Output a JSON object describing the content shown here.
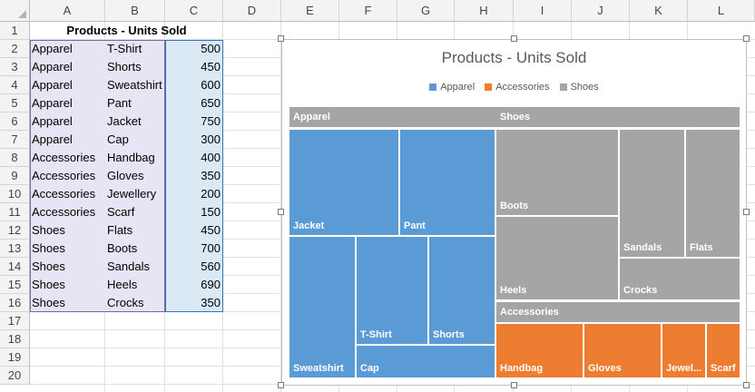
{
  "sheet": {
    "columns": [
      "A",
      "B",
      "C",
      "D",
      "E",
      "F",
      "G",
      "H",
      "I",
      "J",
      "K",
      "L"
    ],
    "rows": [
      "1",
      "2",
      "3",
      "4",
      "5",
      "6",
      "7",
      "8",
      "9",
      "10",
      "11",
      "12",
      "13",
      "14",
      "15",
      "16",
      "17",
      "18",
      "19",
      "20"
    ],
    "title": "Products - Units Sold",
    "data": [
      {
        "category": "Apparel",
        "product": "T-Shirt",
        "units": "500"
      },
      {
        "category": "Apparel",
        "product": "Shorts",
        "units": "450"
      },
      {
        "category": "Apparel",
        "product": "Sweatshirt",
        "units": "600"
      },
      {
        "category": "Apparel",
        "product": "Pant",
        "units": "650"
      },
      {
        "category": "Apparel",
        "product": "Jacket",
        "units": "750"
      },
      {
        "category": "Apparel",
        "product": "Cap",
        "units": "300"
      },
      {
        "category": "Accessories",
        "product": "Handbag",
        "units": "400"
      },
      {
        "category": "Accessories",
        "product": "Gloves",
        "units": "350"
      },
      {
        "category": "Accessories",
        "product": "Jewellery",
        "units": "200"
      },
      {
        "category": "Accessories",
        "product": "Scarf",
        "units": "150"
      },
      {
        "category": "Shoes",
        "product": "Flats",
        "units": "450"
      },
      {
        "category": "Shoes",
        "product": "Boots",
        "units": "700"
      },
      {
        "category": "Shoes",
        "product": "Sandals",
        "units": "560"
      },
      {
        "category": "Shoes",
        "product": "Heels",
        "units": "690"
      },
      {
        "category": "Shoes",
        "product": "Crocks",
        "units": "350"
      }
    ]
  },
  "chart_data": {
    "type": "treemap",
    "title": "Products - Units Sold",
    "legend": {
      "position": "top",
      "entries": [
        "Apparel",
        "Accessories",
        "Shoes"
      ]
    },
    "colors": {
      "Apparel": "#5b9bd5",
      "Accessories": "#ed7d31",
      "Shoes": "#a5a5a5"
    },
    "groups": [
      {
        "name": "Apparel",
        "items": [
          {
            "label": "Jacket",
            "value": 750
          },
          {
            "label": "Pant",
            "value": 650
          },
          {
            "label": "Sweatshirt",
            "value": 600
          },
          {
            "label": "T-Shirt",
            "value": 500
          },
          {
            "label": "Shorts",
            "value": 450
          },
          {
            "label": "Cap",
            "value": 300
          }
        ]
      },
      {
        "name": "Shoes",
        "items": [
          {
            "label": "Boots",
            "value": 700
          },
          {
            "label": "Heels",
            "value": 690
          },
          {
            "label": "Sandals",
            "value": 560
          },
          {
            "label": "Flats",
            "value": 450
          },
          {
            "label": "Crocks",
            "value": 350
          }
        ]
      },
      {
        "name": "Accessories",
        "items": [
          {
            "label": "Handbag",
            "value": 400
          },
          {
            "label": "Gloves",
            "value": 350
          },
          {
            "label": "Jewel...",
            "value": 200
          },
          {
            "label": "Scarf",
            "value": 150
          }
        ]
      }
    ]
  }
}
